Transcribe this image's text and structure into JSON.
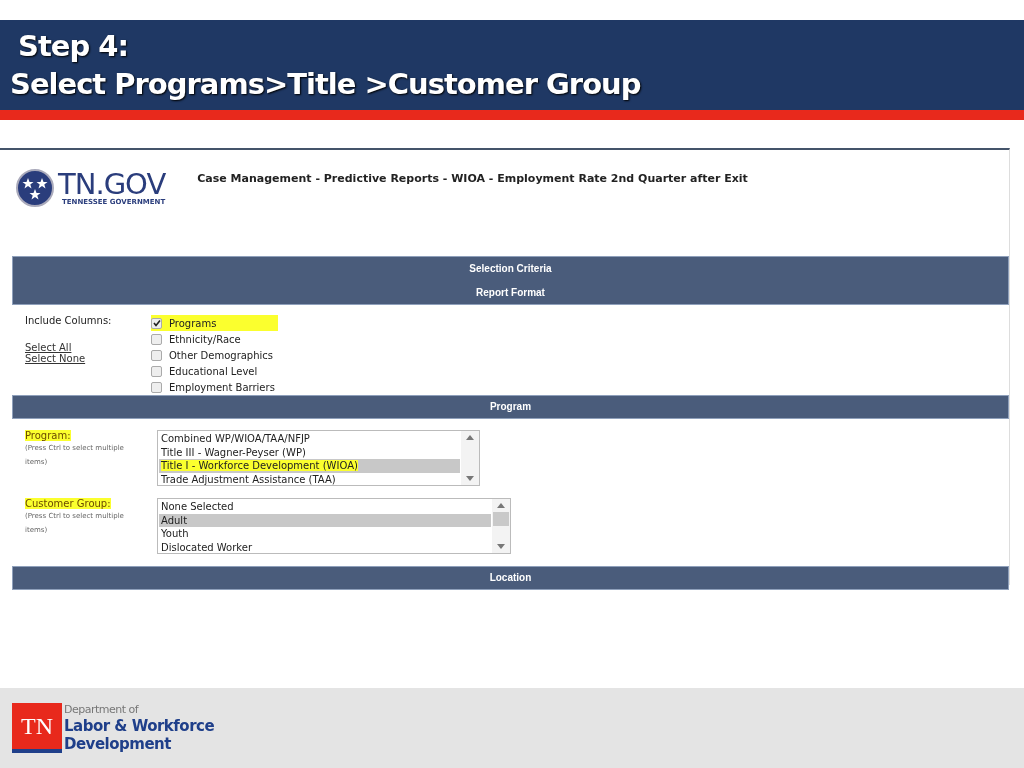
{
  "slide_title": {
    "lines": [
      "Step 4:",
      "Select Programs>Title >Customer Group"
    ]
  },
  "report": {
    "logo": {
      "wordmark": "TN.GOV",
      "tagline": "TENNESSEE GOVERNMENT"
    },
    "page_title": "Case Management - Predictive Reports - WIOA - Employment Rate 2nd Quarter after Exit",
    "criteria_bar": [
      "Selection Criteria",
      "Report Format"
    ],
    "include_columns": {
      "label": "Include Columns:",
      "links": [
        "Select All",
        "Select None"
      ],
      "options": [
        {
          "label": "Programs",
          "checked": true,
          "highlighted": true
        },
        {
          "label": "Ethnicity/Race",
          "checked": false,
          "highlighted": false
        },
        {
          "label": "Other Demographics",
          "checked": false,
          "highlighted": false
        },
        {
          "label": "Educational Level",
          "checked": false,
          "highlighted": false
        },
        {
          "label": "Employment Barriers",
          "checked": false,
          "highlighted": false
        }
      ]
    },
    "program_bar": "Program",
    "lists": [
      {
        "label": "Program:",
        "highlighted": true,
        "hint": "(Press Ctrl to select multiple items)",
        "scroll_thumb": false,
        "options": [
          {
            "label": "Combined WP/WIOA/TAA/NFJP",
            "selected": false,
            "highlighted": false
          },
          {
            "label": "Title III - Wagner-Peyser (WP)",
            "selected": false,
            "highlighted": false
          },
          {
            "label": "Title I - Workforce Development (WIOA)",
            "selected": true,
            "highlighted": true
          },
          {
            "label": "Trade Adjustment Assistance (TAA)",
            "selected": false,
            "highlighted": false
          }
        ]
      },
      {
        "label": "Customer Group:",
        "highlighted": true,
        "hint": "(Press Ctrl to select multiple items)",
        "scroll_thumb": true,
        "options": [
          {
            "label": "None Selected",
            "selected": false,
            "highlighted": false
          },
          {
            "label": "Adult",
            "selected": true,
            "highlighted": false
          },
          {
            "label": "Youth",
            "selected": false,
            "highlighted": false
          },
          {
            "label": "Dislocated Worker",
            "selected": false,
            "highlighted": false
          }
        ]
      }
    ],
    "location_bar": "Location"
  },
  "footer": {
    "logo_mark": "TN",
    "department": [
      "Department of",
      "Labor & Workforce",
      "Development"
    ]
  }
}
